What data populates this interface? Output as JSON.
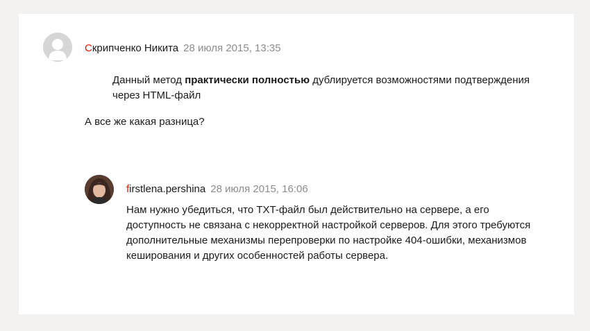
{
  "comment_1": {
    "author_first_letter": "С",
    "author_rest": "крипченко Никита",
    "date": "28 июля 2015, 13:35",
    "quote_before": "Данный метод ",
    "quote_bold": "практически полностью",
    "quote_after": " дублируется возможностями подтверждения через HTML-файл",
    "text": "А все же какая разница?"
  },
  "comment_2": {
    "author_first_letter": "f",
    "author_rest": "irstlena.pershina",
    "date": "28 июля 2015, 16:06",
    "text": "Нам нужно убедиться, что TXT-файл был действительно на сервере, а его доступность не связана с некорректной настройкой серверов. Для этого требуются дополнительные механизмы перепроверки  по настройке 404-ошибки, механизмов кеширования и других особенностей работы сервера."
  },
  "colors": {
    "author_accent": "#e61400",
    "date": "#8c8c8c",
    "page_bg": "#f3f2f0",
    "card_bg": "#ffffff"
  },
  "icons": {
    "avatar_default": "default-user-avatar-icon",
    "avatar_photo": "user-photo-avatar"
  }
}
